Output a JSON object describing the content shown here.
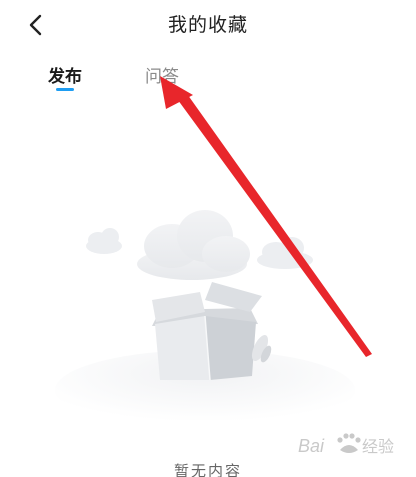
{
  "header": {
    "title": "我的收藏",
    "back_icon": "chevron-left-icon"
  },
  "tabs": [
    {
      "label": "发布",
      "active": true
    },
    {
      "label": "问答",
      "active": false
    }
  ],
  "empty_state": {
    "text": "暂无内容"
  },
  "colors": {
    "accent": "#1e9df2",
    "annotation_arrow": "#e8262b"
  },
  "watermark": {
    "text": "Baidu经验"
  }
}
